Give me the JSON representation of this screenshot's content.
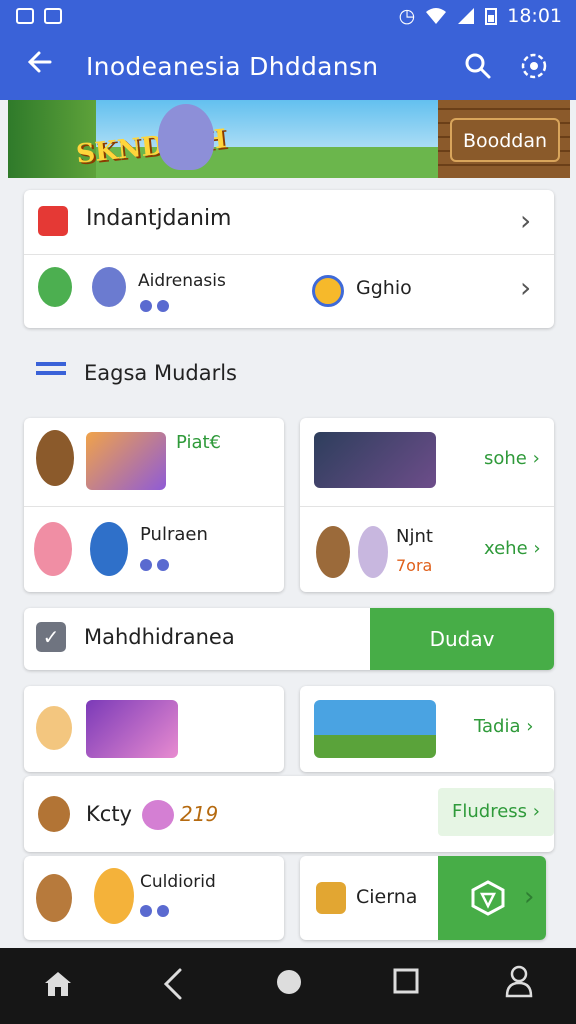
{
  "status_bar": {
    "time": "18:01"
  },
  "app_bar": {
    "title": "Inodeanesia Dhddansn"
  },
  "banner": {
    "logo_text": "SKNDESH",
    "button_label": "Booddan"
  },
  "top_card": {
    "row1_label": "Indantjdanim",
    "row2_label": "Aidrenasis",
    "row2_right_label": "Gghio"
  },
  "section": {
    "title": "Eagsa Mudarls"
  },
  "grid": {
    "card_a": {
      "top_label": "Piat€",
      "bottom_label": "Pulraen"
    },
    "card_b": {
      "top_label": "sohe",
      "bottom_label": "Njnt",
      "bottom_sub": "7ora",
      "bottom_right": "xehe"
    }
  },
  "promo": {
    "label": "Mahdhidranea",
    "button_label": "Dudav"
  },
  "lower": {
    "card_c_right_label": "Tadia",
    "kcty_label": "Kcty",
    "kcty_number": "219",
    "fludress_label": "Fludress",
    "bottom_left_label": "Culdiorid",
    "bottom_right_label": "Cierna"
  },
  "icons": {
    "back": "arrow-left-icon",
    "search": "search-icon",
    "settings": "gear-icon",
    "home": "home-icon",
    "nav_back": "nav-back-icon",
    "circle": "home-circle-icon",
    "square": "recents-square-icon",
    "profile": "person-icon"
  },
  "colors": {
    "app_bar": "#3a62d8",
    "accent_green": "#47ad47",
    "nav_bar": "#161616"
  }
}
